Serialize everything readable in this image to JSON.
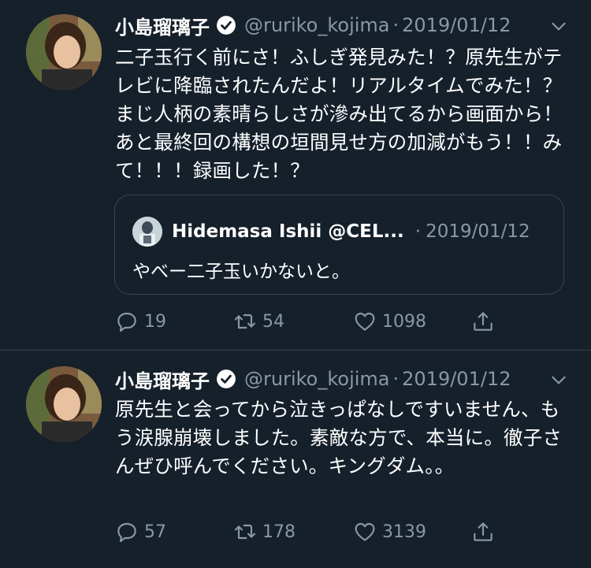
{
  "colors": {
    "background": "#15202b",
    "text": "#ffffff",
    "muted": "#8899a6",
    "border": "#38444d"
  },
  "tweets": [
    {
      "author": {
        "name": "小島瑠璃子",
        "handle": "@ruriko_kojima",
        "verified_icon": "verified-badge-icon"
      },
      "separator": "·",
      "date": "2019/01/12",
      "text": "二子玉行く前にさ！ふしぎ発見みた！？原先生がテレビに降臨されたんだよ！リアルタイムでみた！？まじ人柄の素晴らしさが滲み出てるから画面から！あと最終回の構想の垣間見せ方の加減がもう！！みて！！！録画した！？",
      "quoted": {
        "author": "Hidemasa Ishii @CEL...",
        "separator": "·",
        "date": "2019/01/12",
        "text": "やべー二子玉いかないと。"
      },
      "actions": {
        "reply": "19",
        "retweet": "54",
        "like": "1098"
      }
    },
    {
      "author": {
        "name": "小島瑠璃子",
        "handle": "@ruriko_kojima",
        "verified_icon": "verified-badge-icon"
      },
      "separator": "·",
      "date": "2019/01/12",
      "text": "原先生と会ってから泣きっぱなしですいません、もう涙腺崩壊しました。素敵な方で、本当に。徹子さんぜひ呼んでください。キングダム。。",
      "actions": {
        "reply": "57",
        "retweet": "178",
        "like": "3139"
      }
    }
  ]
}
